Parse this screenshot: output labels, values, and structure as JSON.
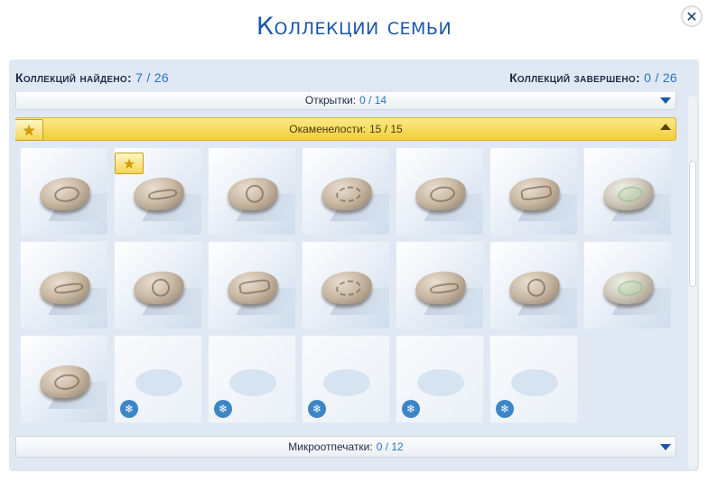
{
  "dialog": {
    "title": "Коллекции семьи",
    "close_icon": "close-icon"
  },
  "stats": {
    "found_label": "Коллекций найдено:",
    "found_value": "7 / 26",
    "completed_label": "Коллекций завершено:",
    "completed_value": "0 / 26"
  },
  "categories": [
    {
      "name": "Открытки:",
      "count": "0 / 14",
      "state": "collapsed"
    },
    {
      "name": "Окаменелости:",
      "count": "15 / 15",
      "state": "expanded",
      "completed": true
    },
    {
      "name": "Микроотпечатки:",
      "count": "0 / 12",
      "state": "collapsed"
    }
  ],
  "fossil_tiles": [
    {
      "found": true,
      "star": false
    },
    {
      "found": true,
      "star": true
    },
    {
      "found": true,
      "star": false
    },
    {
      "found": true,
      "star": false
    },
    {
      "found": true,
      "star": false
    },
    {
      "found": true,
      "star": false
    },
    {
      "found": true,
      "star": false
    },
    {
      "found": true,
      "star": false
    },
    {
      "found": true,
      "star": false
    },
    {
      "found": true,
      "star": false
    },
    {
      "found": true,
      "star": false
    },
    {
      "found": true,
      "star": false
    },
    {
      "found": true,
      "star": false
    },
    {
      "found": true,
      "star": false
    },
    {
      "found": true,
      "star": false
    },
    {
      "found": false,
      "star": false
    },
    {
      "found": false,
      "star": false
    },
    {
      "found": false,
      "star": false
    },
    {
      "found": false,
      "star": false
    },
    {
      "found": false,
      "star": false
    }
  ],
  "colors": {
    "title": "#1c56a8",
    "value": "#2a72c9",
    "active_bar": "#f0cf3a"
  }
}
